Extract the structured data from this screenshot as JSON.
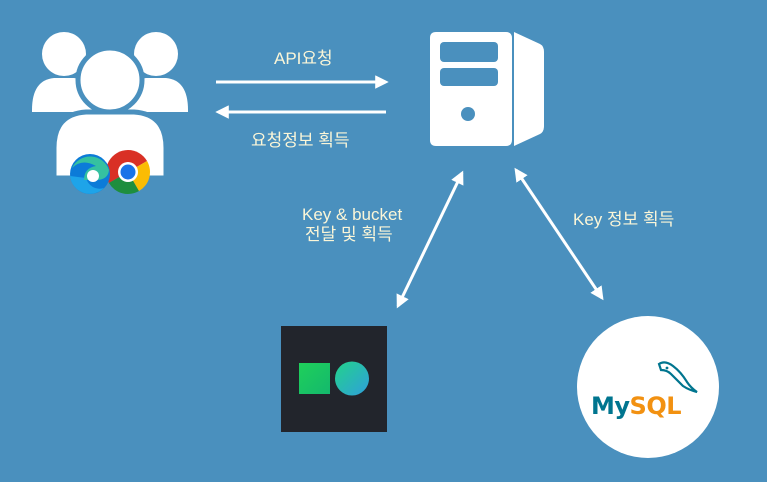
{
  "edges": {
    "api_request": "API요청",
    "request_info": "요청정보 획득",
    "key_bucket_line1": "Key & bucket",
    "key_bucket_line2": "전달 및 획득",
    "key_info": "Key 정보 획득"
  },
  "nodes": {
    "mysql_logo_text": "MySQL",
    "users": "users-icon",
    "browsers": "edge-chrome-icon",
    "server": "server-icon",
    "storage": "storage-logo-icon",
    "database": "mysql-icon"
  },
  "colors": {
    "background": "#4a90be",
    "label": "#fbf6d8",
    "icon": "#ffffff",
    "storage_bg": "#22252c",
    "mysql_blue": "#00758f",
    "mysql_orange": "#f29111"
  }
}
